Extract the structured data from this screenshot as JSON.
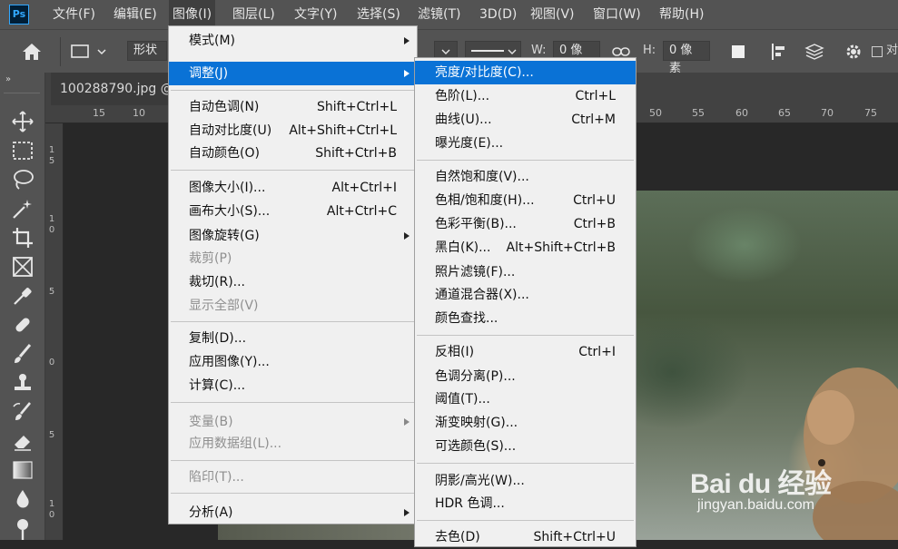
{
  "app": {
    "logo_text": "Ps"
  },
  "menubar": {
    "items": [
      "文件(F)",
      "编辑(E)",
      "图像(I)",
      "图层(L)",
      "文字(Y)",
      "选择(S)",
      "滤镜(T)",
      "3D(D)",
      "视图(V)",
      "窗口(W)",
      "帮助(H)"
    ],
    "active_index": 2
  },
  "options_bar": {
    "shape_label": "形状",
    "w_label": "W:",
    "w_value": "0 像素",
    "h_label": "H:",
    "h_value": "0 像素",
    "checkbox_label": "对"
  },
  "document": {
    "tab_title": "100288790.jpg @"
  },
  "rulers": {
    "h_left": [
      "15",
      "10"
    ],
    "h_right": [
      "50",
      "55",
      "60",
      "65",
      "70",
      "75"
    ],
    "v": [
      [
        "1",
        "5"
      ],
      [
        "1",
        "0"
      ],
      [
        "5"
      ],
      [
        "0"
      ],
      [
        "5"
      ],
      [
        "1",
        "0"
      ]
    ]
  },
  "image_menu": {
    "items": [
      {
        "label": "模式(M)",
        "submenu": true
      },
      {
        "label": "调整(J)",
        "submenu": true,
        "highlighted": true
      },
      {
        "label": "自动色调(N)",
        "shortcut": "Shift+Ctrl+L"
      },
      {
        "label": "自动对比度(U)",
        "shortcut": "Alt+Shift+Ctrl+L"
      },
      {
        "label": "自动颜色(O)",
        "shortcut": "Shift+Ctrl+B"
      },
      {
        "label": "图像大小(I)...",
        "shortcut": "Alt+Ctrl+I"
      },
      {
        "label": "画布大小(S)...",
        "shortcut": "Alt+Ctrl+C"
      },
      {
        "label": "图像旋转(G)",
        "submenu": true
      },
      {
        "label": "裁剪(P)",
        "disabled": true
      },
      {
        "label": "裁切(R)..."
      },
      {
        "label": "显示全部(V)",
        "disabled": true
      },
      {
        "label": "复制(D)..."
      },
      {
        "label": "应用图像(Y)..."
      },
      {
        "label": "计算(C)..."
      },
      {
        "label": "变量(B)",
        "submenu": true,
        "disabled": true
      },
      {
        "label": "应用数据组(L)...",
        "disabled": true
      },
      {
        "label": "陷印(T)...",
        "disabled": true
      },
      {
        "label": "分析(A)",
        "submenu": true
      }
    ]
  },
  "adjust_menu": {
    "items": [
      {
        "label": "亮度/对比度(C)...",
        "highlighted": true
      },
      {
        "label": "色阶(L)...",
        "shortcut": "Ctrl+L"
      },
      {
        "label": "曲线(U)...",
        "shortcut": "Ctrl+M"
      },
      {
        "label": "曝光度(E)..."
      },
      {
        "label": "自然饱和度(V)..."
      },
      {
        "label": "色相/饱和度(H)...",
        "shortcut": "Ctrl+U"
      },
      {
        "label": "色彩平衡(B)...",
        "shortcut": "Ctrl+B"
      },
      {
        "label": "黑白(K)...",
        "shortcut": "Alt+Shift+Ctrl+B"
      },
      {
        "label": "照片滤镜(F)..."
      },
      {
        "label": "通道混合器(X)..."
      },
      {
        "label": "颜色查找..."
      },
      {
        "label": "反相(I)",
        "shortcut": "Ctrl+I"
      },
      {
        "label": "色调分离(P)..."
      },
      {
        "label": "阈值(T)..."
      },
      {
        "label": "渐变映射(G)..."
      },
      {
        "label": "可选颜色(S)..."
      },
      {
        "label": "阴影/高光(W)..."
      },
      {
        "label": "HDR 色调..."
      },
      {
        "label": "去色(D)",
        "shortcut": "Shift+Ctrl+U"
      }
    ]
  },
  "watermark": {
    "logo_text": "Bai du 经验",
    "url": "jingyan.baidu.com"
  },
  "colors": {
    "highlight": "#0a72d6",
    "menu_bg": "#f0f0f0",
    "chrome": "#535353"
  }
}
